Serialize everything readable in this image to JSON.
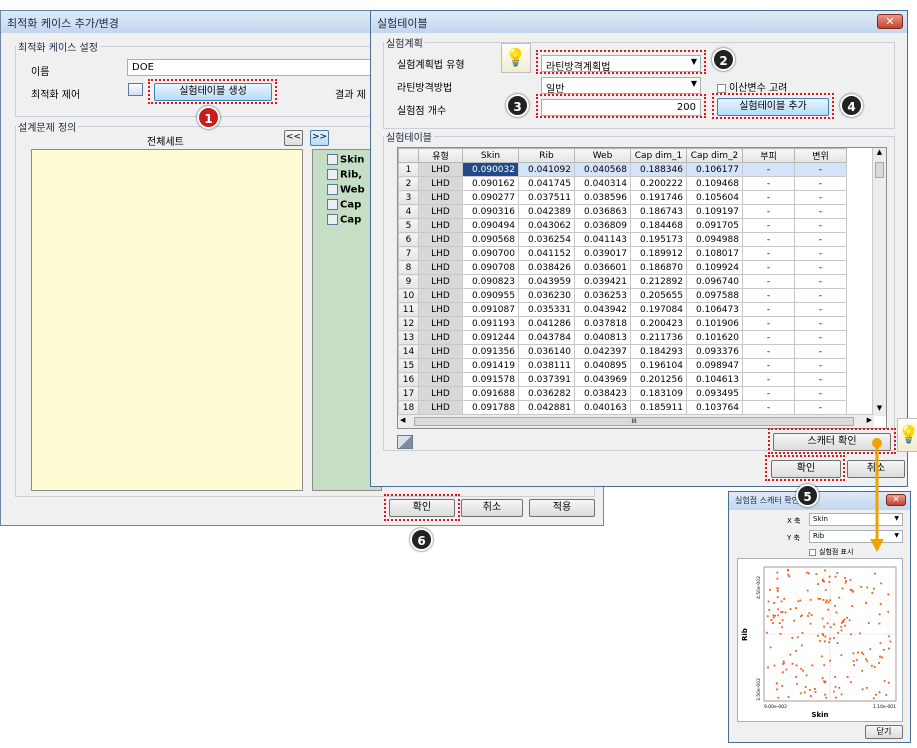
{
  "main_window": {
    "title": "최적화 케이스 추가/변경",
    "settings_group": "최적화 케이스 설정",
    "name_label": "이름",
    "name_value": "DOE",
    "control_label": "최적화 제어",
    "create_table_button": "실험테이블 생성",
    "result_label": "결과 제",
    "problem_group": "설계문제 정의",
    "full_set_label": "전체세트",
    "move_left": "<<",
    "move_right": ">>",
    "tree_items": [
      "Skin",
      "Rib,",
      "Web",
      "Cap",
      "Cap"
    ],
    "ok_button": "확인",
    "cancel_button": "취소",
    "apply_button": "적용"
  },
  "exp_dialog": {
    "title": "실험테이블",
    "close": "✕",
    "plan_group": "실험계획",
    "method_type_label": "실험계획법 유형",
    "method_type_value": "라틴방격계획법",
    "latin_method_label": "라틴방격방법",
    "latin_method_value": "일반",
    "discrete_checkbox": "이산변수 고려",
    "point_count_label": "실험점 개수",
    "point_count_value": "200",
    "add_table_button": "실험테이블 추가",
    "table_group": "실험테이블",
    "columns": [
      "",
      "유형",
      "Skin",
      "Rib",
      "Web",
      "Cap dim_1",
      "Cap dim_2",
      "부피",
      "변위"
    ],
    "rows": [
      [
        "1",
        "LHD",
        "0.090032",
        "0.041092",
        "0.040568",
        "0.188346",
        "0.106177",
        "-",
        "-"
      ],
      [
        "2",
        "LHD",
        "0.090162",
        "0.041745",
        "0.040314",
        "0.200222",
        "0.109468",
        "-",
        "-"
      ],
      [
        "3",
        "LHD",
        "0.090277",
        "0.037511",
        "0.038596",
        "0.191746",
        "0.105604",
        "-",
        "-"
      ],
      [
        "4",
        "LHD",
        "0.090316",
        "0.042389",
        "0.036863",
        "0.186743",
        "0.109197",
        "-",
        "-"
      ],
      [
        "5",
        "LHD",
        "0.090494",
        "0.043062",
        "0.036809",
        "0.184468",
        "0.091705",
        "-",
        "-"
      ],
      [
        "6",
        "LHD",
        "0.090568",
        "0.036254",
        "0.041143",
        "0.195173",
        "0.094988",
        "-",
        "-"
      ],
      [
        "7",
        "LHD",
        "0.090700",
        "0.041152",
        "0.039017",
        "0.189912",
        "0.108017",
        "-",
        "-"
      ],
      [
        "8",
        "LHD",
        "0.090708",
        "0.038426",
        "0.036601",
        "0.186870",
        "0.109924",
        "-",
        "-"
      ],
      [
        "9",
        "LHD",
        "0.090823",
        "0.043959",
        "0.039421",
        "0.212892",
        "0.096740",
        "-",
        "-"
      ],
      [
        "10",
        "LHD",
        "0.090955",
        "0.036230",
        "0.036253",
        "0.205655",
        "0.097588",
        "-",
        "-"
      ],
      [
        "11",
        "LHD",
        "0.091087",
        "0.035331",
        "0.043942",
        "0.197084",
        "0.106473",
        "-",
        "-"
      ],
      [
        "12",
        "LHD",
        "0.091193",
        "0.041286",
        "0.037818",
        "0.200423",
        "0.101906",
        "-",
        "-"
      ],
      [
        "13",
        "LHD",
        "0.091244",
        "0.043784",
        "0.040813",
        "0.211736",
        "0.101620",
        "-",
        "-"
      ],
      [
        "14",
        "LHD",
        "0.091356",
        "0.036140",
        "0.042397",
        "0.184293",
        "0.093376",
        "-",
        "-"
      ],
      [
        "15",
        "LHD",
        "0.091419",
        "0.038111",
        "0.040895",
        "0.196104",
        "0.098947",
        "-",
        "-"
      ],
      [
        "16",
        "LHD",
        "0.091578",
        "0.037391",
        "0.043969",
        "0.201256",
        "0.104613",
        "-",
        "-"
      ],
      [
        "17",
        "LHD",
        "0.091688",
        "0.036282",
        "0.038423",
        "0.183109",
        "0.093495",
        "-",
        "-"
      ],
      [
        "18",
        "LHD",
        "0.091788",
        "0.042881",
        "0.040163",
        "0.185911",
        "0.103764",
        "-",
        "-"
      ]
    ],
    "scroll_mark": "III",
    "scatter_button": "스캐터 확인",
    "ok_button": "확인",
    "cancel_button": "취소"
  },
  "scatter_window": {
    "title": "실험점 스캐터 확인",
    "x_axis_label": "X 축",
    "x_axis_value": "Skin",
    "y_axis_label": "Y 축",
    "y_axis_value": "Rib",
    "show_points_checkbox": "실험점 표시",
    "chart_ylabel": "Rib",
    "chart_xlabel": "Skin",
    "x_ticks": [
      "9.00e-002",
      "1.10e-001"
    ],
    "y_ticks": [
      "3.50e-002",
      "4.50e-002"
    ],
    "close_button": "닫기"
  },
  "badges": [
    "1",
    "2",
    "3",
    "4",
    "5",
    "6"
  ],
  "colors": {
    "accent_red": "#e0141b",
    "point_orange": "#f05a1a",
    "arrow_orange": "#f0a300",
    "tree_bg": "#c6dfc4",
    "list_bg": "#fffbd5"
  }
}
